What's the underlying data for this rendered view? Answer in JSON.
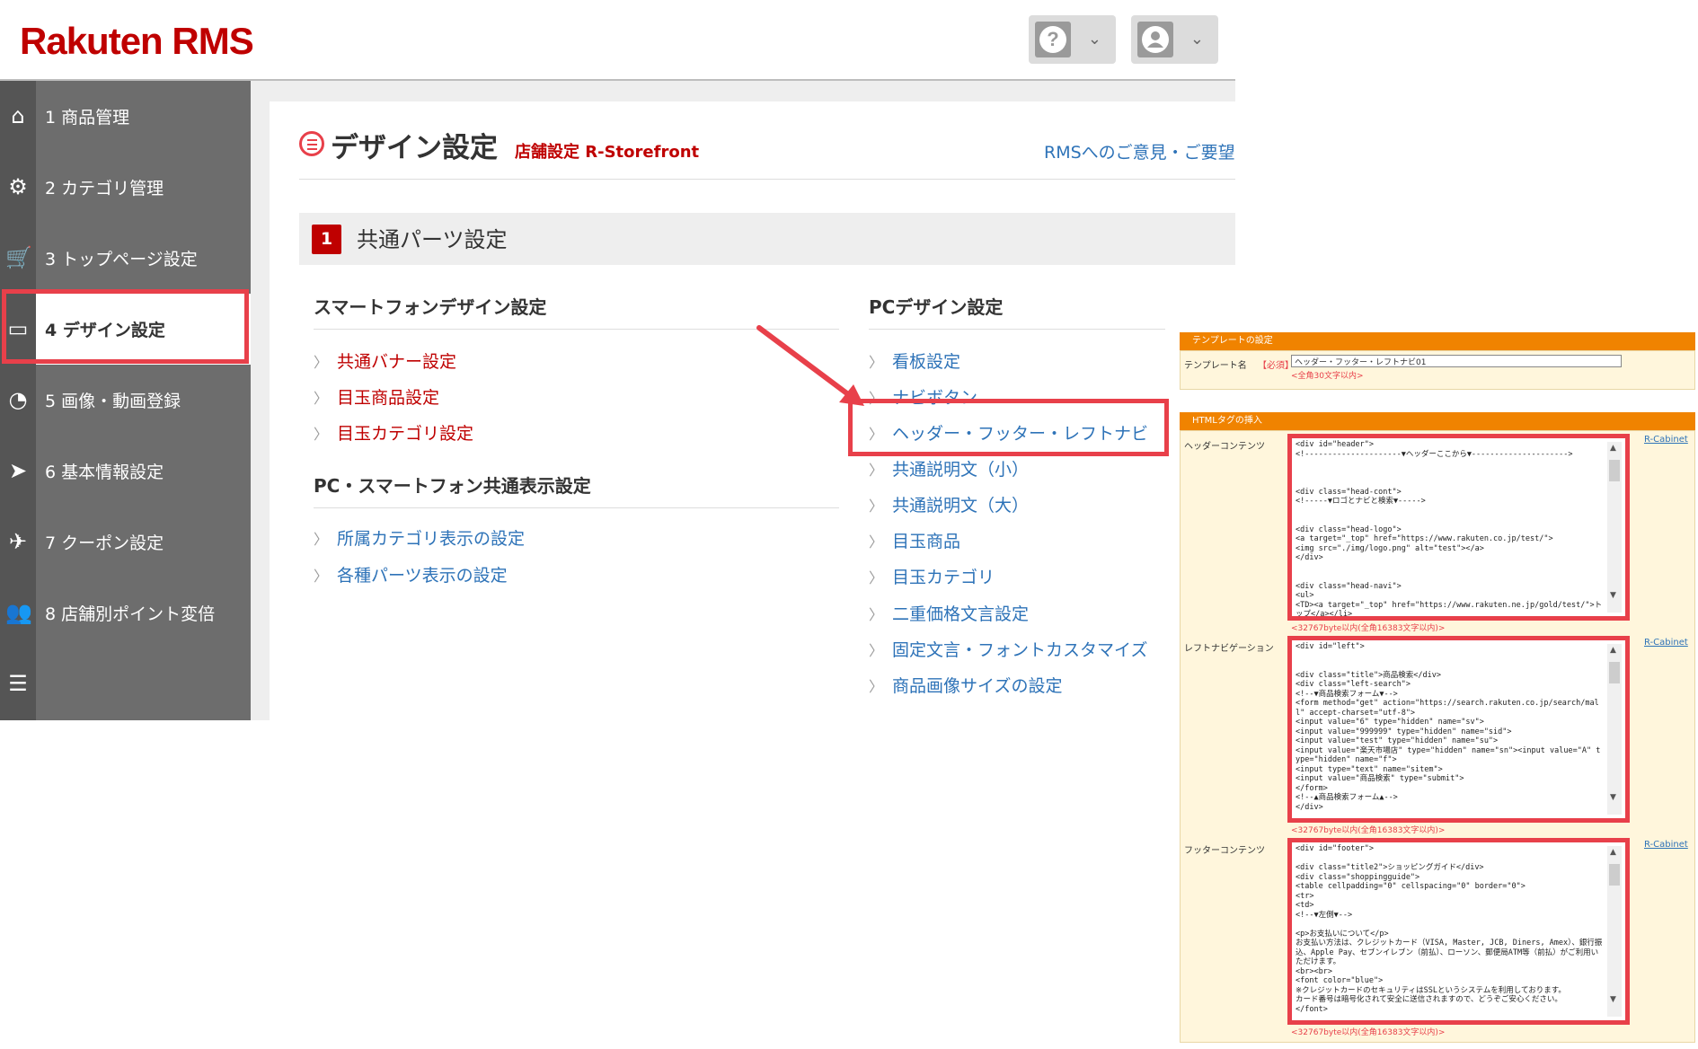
{
  "header": {
    "logo": "Rakuten RMS",
    "help_icon": "?",
    "help_chevron": "⌄",
    "user_chevron": "⌄"
  },
  "sidebar": {
    "items": [
      {
        "label": "1 商品管理",
        "icon": "home-icon",
        "glyph": "⌂"
      },
      {
        "label": "2 カテゴリ管理",
        "icon": "gear-icon",
        "glyph": "⚙"
      },
      {
        "label": "3 トップページ設定",
        "icon": "cart-icon",
        "glyph": "🛒"
      },
      {
        "label": "4 デザイン設定",
        "icon": "design-icon",
        "glyph": "▭"
      },
      {
        "label": "5 画像・動画登録",
        "icon": "pie-icon",
        "glyph": "◔"
      },
      {
        "label": "6 基本情報設定",
        "icon": "send-icon",
        "glyph": "➤"
      },
      {
        "label": "7 クーポン設定",
        "icon": "rocket-icon",
        "glyph": "✈"
      },
      {
        "label": "8 店舗別ポイント変倍",
        "icon": "users-icon",
        "glyph": "👥"
      },
      {
        "label": "",
        "icon": "list-icon",
        "glyph": "☰"
      }
    ]
  },
  "main": {
    "title": "デザイン設定",
    "subtitle": "店舗設定 R-Storefront",
    "feedback_link": "RMSへのご意見・ご要望",
    "section_number": "1",
    "section_title": "共通パーツ設定",
    "sp_design": {
      "heading": "スマートフォンデザイン設定",
      "links": [
        "共通バナー設定",
        "目玉商品設定",
        "目玉カテゴリ設定"
      ]
    },
    "common_display": {
      "heading": "PC・スマートフォン共通表示設定",
      "links": [
        "所属カテゴリ表示の設定",
        "各種パーツ表示の設定"
      ]
    },
    "pc_design": {
      "heading": "PCデザイン設定",
      "links": [
        "看板設定",
        "ナビボタン",
        "ヘッダー・フッター・レフトナビ",
        "共通説明文（小）",
        "共通説明文（大）",
        "目玉商品",
        "目玉カテゴリ",
        "二重価格文言設定",
        "固定文言・フォントカスタマイズ",
        "商品画像サイズの設定"
      ]
    }
  },
  "template_panel": {
    "settings_header": "テンプレートの設定",
    "template_name_label": "テンプレート名",
    "required_label": "【必須】",
    "template_name_value": "ヘッダー・フッター・レフトナビ01",
    "template_name_note": "<全角30文字以内>",
    "html_header": "HTMLタグの挿入",
    "cabinet_link": "R-Cabinet",
    "byte_note": "<32767byte以内(全角16383文字以内)>",
    "header_content": {
      "label": "ヘッダーコンテンツ",
      "code": "<div id=\"header\">\n<!---------------------▼ヘッダーここから▼--------------------->\n\n\n\n<div class=\"head-cont\">\n<!-----▼ロゴとナビと検索▼----->\n\n\n<div class=\"head-logo\">\n<a target=\"_top\" href=\"https://www.rakuten.co.jp/test/\">\n<img src=\"./img/logo.png\" alt=\"test\"></a>\n</div>\n\n\n<div class=\"head-navi\">\n<ul>\n<TD><a target=\"_top\" href=\"https://www.rakuten.ne.jp/gold/test/\">トップ</a></li>\n<li><a target=\"_top\""
    },
    "left_navi": {
      "label": "レフトナビゲーション",
      "code": "<div id=\"left\">\n\n\n<div class=\"title\">商品検索</div>\n<div class=\"left-search\">\n<!--▼商品検索フォーム▼-->\n<form method=\"get\" action=\"https://search.rakuten.co.jp/search/mall\" accept-charset=\"utf-8\">\n<input value=\"6\" type=\"hidden\" name=\"sv\">\n<input value=\"999999\" type=\"hidden\" name=\"sid\">\n<input value=\"test\" type=\"hidden\" name=\"su\">\n<input value=\"楽天市場店\" type=\"hidden\" name=\"sn\"><input value=\"A\" type=\"hidden\" name=\"f\">\n<input type=\"text\" name=\"sitem\">\n<input value=\"商品検索\" type=\"submit\">\n</form>\n<!--▲商品検索フォーム▲-->\n</div>"
    },
    "footer_content": {
      "label": "フッターコンテンツ",
      "code": "<div id=\"footer\">\n\n<div class=\"title2\">ショッピングガイド</div>\n<div class=\"shoppingguide\">\n<table cellpadding=\"0\" cellspacing=\"0\" border=\"0\">\n<tr>\n<td>\n<!--▼左側▼-->\n\n<p>お支払いについて</p>\nお支払い方法は、クレジットカード（VISA, Master, JCB, Diners, Amex）、銀行振込、Apple Pay、セブンイレブン（前払）、ローソン、郵便局ATM等（前払）がご利用いただけます。\n<br><br>\n<font color=\"blue\">\n※クレジットカードのセキュリティはSSLというシステムを利用しております。\nカード番号は暗号化されて安全に送信されますので、どうぞご安心ください。\n</font>"
    }
  },
  "colors": {
    "brand_red": "#bf0000",
    "highlight_red": "#e8404a",
    "link_blue": "#2e73b8",
    "sidebar_gray": "#6d6d6d",
    "panel_orange": "#f08300"
  }
}
